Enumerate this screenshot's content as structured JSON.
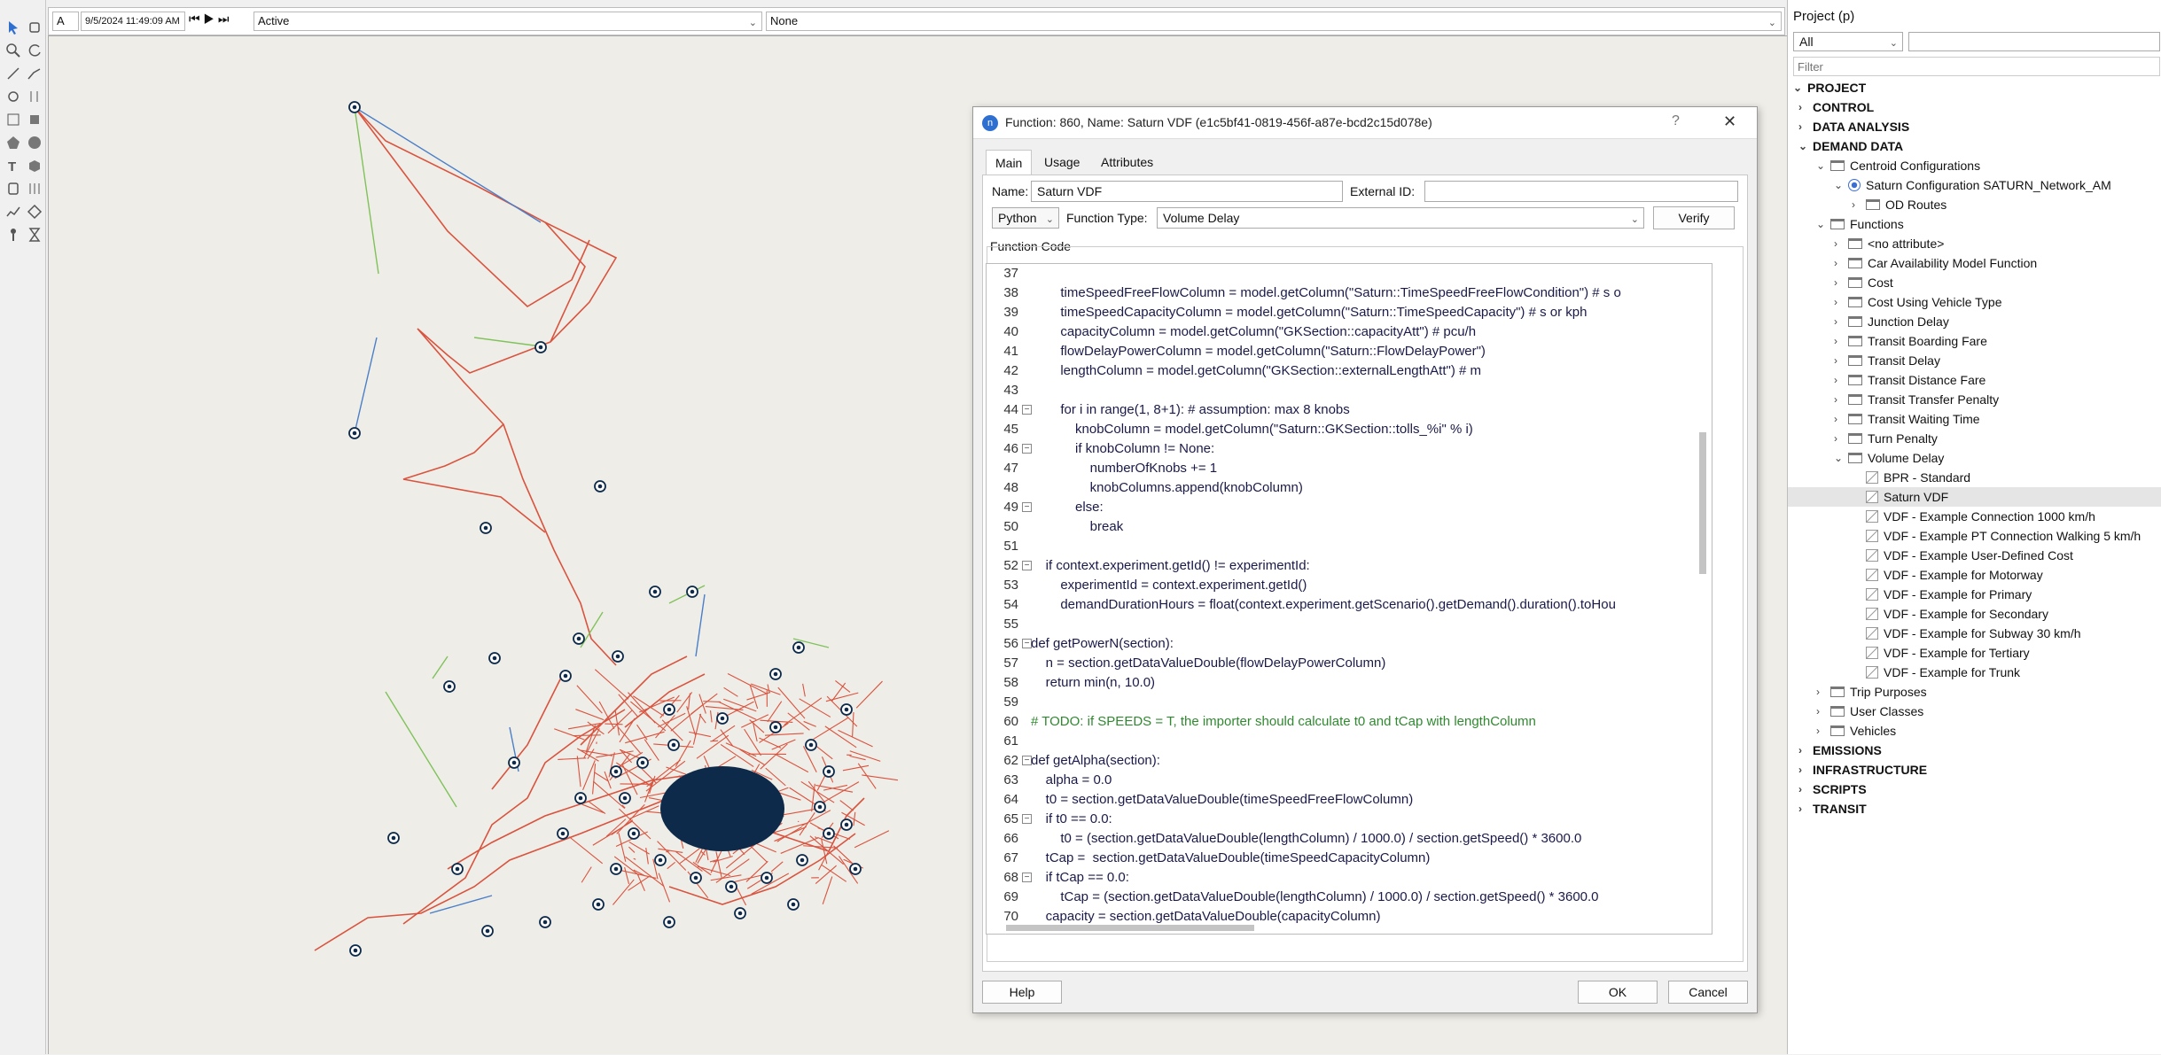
{
  "toolbar": {
    "mode": "A",
    "datetime": "9/5/2024 11:49:09 AM",
    "status": "Active",
    "filter": "None"
  },
  "dialog": {
    "title": "Function: 860, Name: Saturn VDF  (e1c5bf41-0819-456f-a87e-bcd2c15d078e)",
    "help_glyph": "?",
    "close_glyph": "✕",
    "tabs": [
      "Main",
      "Usage",
      "Attributes"
    ],
    "name_label": "Name:",
    "name_value": "Saturn VDF",
    "external_id_label": "External ID:",
    "external_id_value": "",
    "language": "Python",
    "function_type_label": "Function Type:",
    "function_type_value": "Volume Delay",
    "verify_label": "Verify",
    "code_label": "Function Code",
    "help_button": "Help",
    "ok_button": "OK",
    "cancel_button": "Cancel",
    "code_lines": [
      {
        "n": "37",
        "t": ""
      },
      {
        "n": "38",
        "t": "        timeSpeedFreeFlowColumn = model.getColumn(\"Saturn::TimeSpeedFreeFlowCondition\") # s o"
      },
      {
        "n": "39",
        "t": "        timeSpeedCapacityColumn = model.getColumn(\"Saturn::TimeSpeedCapacity\") # s or kph"
      },
      {
        "n": "40",
        "t": "        capacityColumn = model.getColumn(\"GKSection::capacityAtt\") # pcu/h"
      },
      {
        "n": "41",
        "t": "        flowDelayPowerColumn = model.getColumn(\"Saturn::FlowDelayPower\")"
      },
      {
        "n": "42",
        "t": "        lengthColumn = model.getColumn(\"GKSection::externalLengthAtt\") # m"
      },
      {
        "n": "43",
        "t": ""
      },
      {
        "n": "44",
        "t": "        for i in range(1, 8+1): # assumption: max 8 knobs",
        "fold": true
      },
      {
        "n": "45",
        "t": "            knobColumn = model.getColumn(\"Saturn::GKSection::tolls_%i\" % i)"
      },
      {
        "n": "46",
        "t": "            if knobColumn != None:",
        "fold": true
      },
      {
        "n": "47",
        "t": "                numberOfKnobs += 1"
      },
      {
        "n": "48",
        "t": "                knobColumns.append(knobColumn)"
      },
      {
        "n": "49",
        "t": "            else:",
        "fold": true
      },
      {
        "n": "50",
        "t": "                break"
      },
      {
        "n": "51",
        "t": ""
      },
      {
        "n": "52",
        "t": "    if context.experiment.getId() != experimentId:",
        "fold": true
      },
      {
        "n": "53",
        "t": "        experimentId = context.experiment.getId()"
      },
      {
        "n": "54",
        "t": "        demandDurationHours = float(context.experiment.getScenario().getDemand().duration().toHou"
      },
      {
        "n": "55",
        "t": ""
      },
      {
        "n": "56",
        "t": "def getPowerN(section):",
        "fold": true
      },
      {
        "n": "57",
        "t": "    n = section.getDataValueDouble(flowDelayPowerColumn)"
      },
      {
        "n": "58",
        "t": "    return min(n, 10.0)"
      },
      {
        "n": "59",
        "t": ""
      },
      {
        "n": "60",
        "t": "# TODO: if SPEEDS = T, the importer should calculate t0 and tCap with lengthColumn"
      },
      {
        "n": "61",
        "t": ""
      },
      {
        "n": "62",
        "t": "def getAlpha(section):",
        "fold": true
      },
      {
        "n": "63",
        "t": "    alpha = 0.0"
      },
      {
        "n": "64",
        "t": "    t0 = section.getDataValueDouble(timeSpeedFreeFlowColumn)"
      },
      {
        "n": "65",
        "t": "    if t0 == 0.0:",
        "fold": true
      },
      {
        "n": "66",
        "t": "        t0 = (section.getDataValueDouble(lengthColumn) / 1000.0) / section.getSpeed() * 3600.0"
      },
      {
        "n": "67",
        "t": "    tCap =  section.getDataValueDouble(timeSpeedCapacityColumn)"
      },
      {
        "n": "68",
        "t": "    if tCap == 0.0:",
        "fold": true
      },
      {
        "n": "69",
        "t": "        tCap = (section.getDataValueDouble(lengthColumn) / 1000.0) / section.getSpeed() * 3600.0"
      },
      {
        "n": "70",
        "t": "    capacity = section.getDataValueDouble(capacityColumn)"
      }
    ]
  },
  "project": {
    "title": "Project (p)",
    "scope": "All",
    "search_value": "",
    "filter_placeholder": "Filter",
    "tree": [
      {
        "label": "PROJECT",
        "level": 0,
        "arrow": "down",
        "bold": true
      },
      {
        "label": "CONTROL",
        "level": 1,
        "arrow": "right",
        "bold": true
      },
      {
        "label": "DATA ANALYSIS",
        "level": 1,
        "arrow": "right",
        "bold": true
      },
      {
        "label": "DEMAND DATA",
        "level": 1,
        "arrow": "down",
        "bold": true
      },
      {
        "label": "Centroid Configurations",
        "level": 2,
        "arrow": "down",
        "icon": "folder"
      },
      {
        "label": "Saturn Configuration SATURN_Network_AM",
        "level": 3,
        "arrow": "down",
        "icon": "radio"
      },
      {
        "label": "OD Routes",
        "level": 4,
        "arrow": "right",
        "icon": "folder"
      },
      {
        "label": "Functions",
        "level": 2,
        "arrow": "down",
        "icon": "folder"
      },
      {
        "label": "<no attribute>",
        "level": 3,
        "arrow": "right",
        "icon": "folder"
      },
      {
        "label": "Car Availability Model Function",
        "level": 3,
        "arrow": "right",
        "icon": "folder"
      },
      {
        "label": "Cost",
        "level": 3,
        "arrow": "right",
        "icon": "folder"
      },
      {
        "label": "Cost Using Vehicle Type",
        "level": 3,
        "arrow": "right",
        "icon": "folder"
      },
      {
        "label": "Junction Delay",
        "level": 3,
        "arrow": "right",
        "icon": "folder"
      },
      {
        "label": "Transit Boarding Fare",
        "level": 3,
        "arrow": "right",
        "icon": "folder"
      },
      {
        "label": "Transit Delay",
        "level": 3,
        "arrow": "right",
        "icon": "folder"
      },
      {
        "label": "Transit Distance Fare",
        "level": 3,
        "arrow": "right",
        "icon": "folder"
      },
      {
        "label": "Transit Transfer Penalty",
        "level": 3,
        "arrow": "right",
        "icon": "folder"
      },
      {
        "label": "Transit Waiting Time",
        "level": 3,
        "arrow": "right",
        "icon": "folder"
      },
      {
        "label": "Turn Penalty",
        "level": 3,
        "arrow": "right",
        "icon": "folder"
      },
      {
        "label": "Volume Delay",
        "level": 3,
        "arrow": "down",
        "icon": "folder"
      },
      {
        "label": "BPR - Standard",
        "level": 4,
        "arrow": "",
        "icon": "function"
      },
      {
        "label": "Saturn VDF",
        "level": 4,
        "arrow": "",
        "icon": "function",
        "selected": true
      },
      {
        "label": "VDF - Example Connection 1000 km/h",
        "level": 4,
        "arrow": "",
        "icon": "function"
      },
      {
        "label": "VDF - Example PT Connection Walking 5 km/h",
        "level": 4,
        "arrow": "",
        "icon": "function"
      },
      {
        "label": "VDF - Example User-Defined Cost",
        "level": 4,
        "arrow": "",
        "icon": "function"
      },
      {
        "label": "VDF - Example for Motorway",
        "level": 4,
        "arrow": "",
        "icon": "function"
      },
      {
        "label": "VDF - Example for Primary",
        "level": 4,
        "arrow": "",
        "icon": "function"
      },
      {
        "label": "VDF - Example for Secondary",
        "level": 4,
        "arrow": "",
        "icon": "function"
      },
      {
        "label": "VDF - Example for Subway 30 km/h",
        "level": 4,
        "arrow": "",
        "icon": "function"
      },
      {
        "label": "VDF - Example for Tertiary",
        "level": 4,
        "arrow": "",
        "icon": "function"
      },
      {
        "label": "VDF - Example for Trunk",
        "level": 4,
        "arrow": "",
        "icon": "function"
      },
      {
        "label": "Trip Purposes",
        "level": 2,
        "arrow": "right",
        "icon": "folder"
      },
      {
        "label": "User Classes",
        "level": 2,
        "arrow": "right",
        "icon": "folder"
      },
      {
        "label": "Vehicles",
        "level": 2,
        "arrow": "right",
        "icon": "folder"
      },
      {
        "label": "EMISSIONS",
        "level": 1,
        "arrow": "right",
        "bold": true
      },
      {
        "label": "INFRASTRUCTURE",
        "level": 1,
        "arrow": "right",
        "bold": true
      },
      {
        "label": "SCRIPTS",
        "level": 1,
        "arrow": "right",
        "bold": true
      },
      {
        "label": "TRANSIT",
        "level": 1,
        "arrow": "right",
        "bold": true
      }
    ]
  },
  "tools": [
    "select-icon",
    "pan-icon",
    "zoom-icon",
    "rotate-icon",
    "draw-section-icon",
    "draw-polyline-icon",
    "node-icon",
    "split-icon",
    "centroid-icon",
    "junction-icon",
    "polygon-icon",
    "circle-icon",
    "text-icon",
    "cube-icon",
    "bus-stop-icon",
    "detector-icon",
    "chart-icon",
    "layers-icon",
    "signal-icon",
    "hourglass-icon"
  ],
  "colors": {
    "road": "#d9533e",
    "connector_green": "#7fc25a",
    "connector_blue": "#4a7fc9",
    "centroid": "#0d2a4a",
    "selection": "#e5e5e5"
  }
}
